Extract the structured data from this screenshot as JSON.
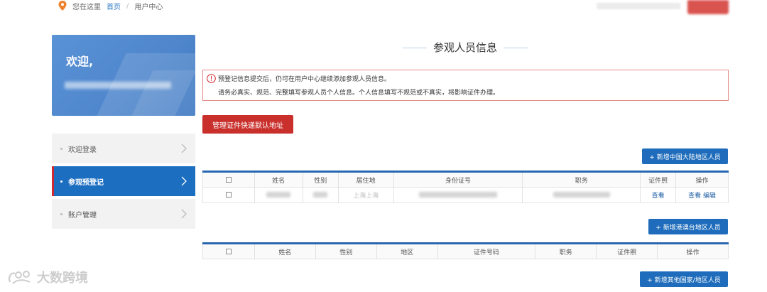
{
  "breadcrumb": {
    "location_label": "您在这里",
    "home_link": "首页",
    "separator": "/",
    "current": "用户中心"
  },
  "sidebar": {
    "welcome_title": "欢迎,",
    "items": [
      {
        "label": "欢迎登录",
        "active": false
      },
      {
        "label": "参观预登记",
        "active": true
      },
      {
        "label": "账户管理",
        "active": false
      }
    ]
  },
  "main": {
    "section_title": "参观人员信息",
    "notice_line1": "预登记信息提交后，仍可在用户中心继续添加参观人员信息。",
    "notice_line2": "请务必真实、规范、完整填写参观人员个人信息。个人信息填写不规范或不真实，将影响证件办理。",
    "manage_address_button": "管理证件快递默认地址",
    "add_mainland_button": "+ 新增中国大陆地区人员",
    "add_hkmt_button": "+ 新增港澳台地区人员",
    "add_other_button": "+ 新增其他国家/地区人员",
    "mainland_table": {
      "headers": [
        "姓名",
        "性别",
        "居住地",
        "身份证号",
        "职务",
        "证件照",
        "操作"
      ],
      "row": {
        "residence": "上海上海",
        "photo_action": "查看",
        "op_view": "查看",
        "op_edit": "编辑"
      }
    },
    "hkmt_table": {
      "headers": [
        "姓名",
        "性别",
        "地区",
        "证件号码",
        "职务",
        "证件照",
        "操作"
      ]
    }
  },
  "watermark": "大数跨境",
  "colors": {
    "primary_blue": "#1e6cbb",
    "danger_red": "#c9302c",
    "active_menu": "#1c6ec1"
  }
}
